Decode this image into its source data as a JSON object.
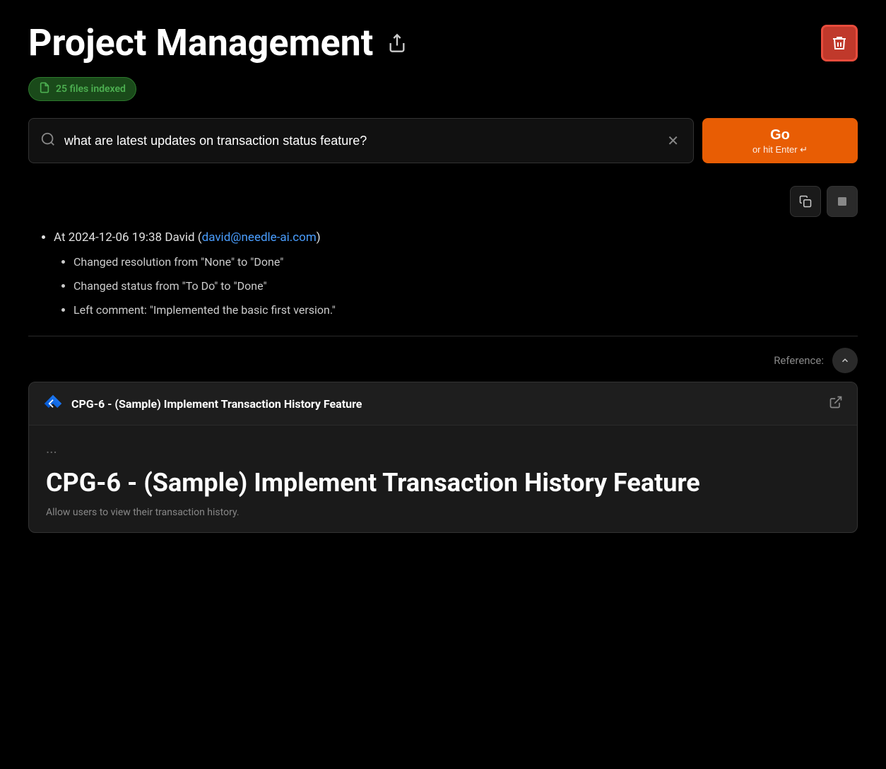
{
  "header": {
    "title": "Project Management",
    "share_icon": "↗",
    "delete_icon": "🗑"
  },
  "files_badge": {
    "icon": "📄",
    "label": "25 files indexed"
  },
  "search": {
    "placeholder": "what are latest updates on transaction status feature?",
    "value": "what are latest updates on transaction status feature?",
    "clear_icon": "✕",
    "go_label": "Go",
    "go_sub": "or hit Enter ↵"
  },
  "result": {
    "copy_icon": "⧉",
    "collapse_icon": "■",
    "bullet_item": "At 2024-12-06 19:38 David (",
    "email": "david@needle-ai.com",
    "email_suffix": ")",
    "sub_items": [
      "Changed resolution from \"None\" to \"Done\"",
      "Changed status from \"To Do\" to \"Done\"",
      "Left comment: \"Implemented the basic first version.\""
    ]
  },
  "reference": {
    "label": "Reference:",
    "card": {
      "title": "CPG-6 - (Sample) Implement Transaction History Feature",
      "main_title": "CPG-6 - (Sample) Implement Transaction History Feature",
      "description": "Allow users to view their transaction history.",
      "dots": "..."
    }
  }
}
